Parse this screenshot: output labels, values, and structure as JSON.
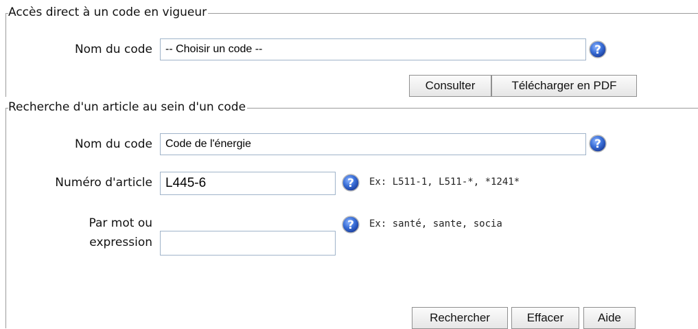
{
  "section1": {
    "legend": "Accès direct à un code en vigueur",
    "code_label": "Nom du code",
    "code_value": "-- Choisir un code --",
    "buttons": {
      "consult": "Consulter",
      "download_pdf": "Télécharger en PDF"
    }
  },
  "section2": {
    "legend": "Recherche d'un article au sein d'un code",
    "code_label": "Nom du code",
    "code_value": "Code de l'énergie",
    "article_label": "Numéro d'article",
    "article_value": "L445-6",
    "article_hint": "Ex: L511-1, L511-*, *1241*",
    "keyword_label_line1": "Par mot ou",
    "keyword_label_line2": "expression",
    "keyword_value": "",
    "keyword_hint": "Ex: santé, sante, socia",
    "buttons": {
      "search": "Rechercher",
      "clear": "Effacer",
      "help": "Aide"
    }
  },
  "colors": {
    "help_icon": "#3366cc",
    "border": "#9a9a9a",
    "input_border": "#9fb3c9"
  },
  "icons": {
    "help": "question-mark-circle-icon"
  }
}
